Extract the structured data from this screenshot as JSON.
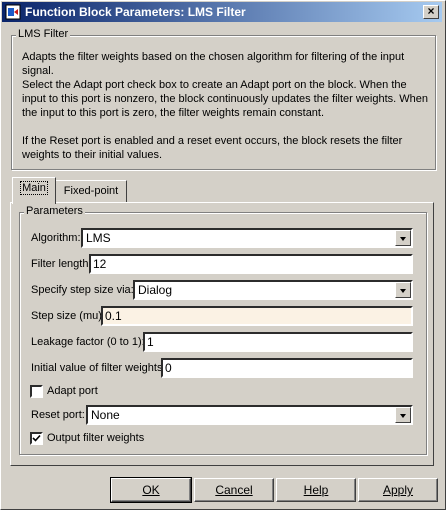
{
  "window": {
    "title": "Function Block Parameters: LMS Filter",
    "close_label": "×"
  },
  "block": {
    "name": "LMS Filter",
    "desc1": "Adapts the filter weights based on the chosen algorithm for filtering of the input signal.",
    "desc2": "Select the Adapt port check box to create an Adapt port on the block. When the input to this port is nonzero, the block continuously updates the filter weights. When the input to this port is zero, the filter weights remain constant.",
    "desc3": "If the Reset port is enabled and a reset event occurs, the block resets the filter weights to their initial values."
  },
  "tabs": [
    {
      "label": "Main",
      "active": true
    },
    {
      "label": "Fixed-point",
      "active": false
    }
  ],
  "params": {
    "group_label": "Parameters",
    "algorithm_label": "Algorithm:",
    "algorithm_value": "LMS",
    "filter_length_label": "Filter length:",
    "filter_length_value": "12",
    "step_via_label": "Specify step size via:",
    "step_via_value": "Dialog",
    "step_size_label": "Step size (mu):",
    "step_size_value": "0.1",
    "leakage_label": "Leakage factor (0 to 1):",
    "leakage_value": "1",
    "init_weights_label": "Initial value of filter weights:",
    "init_weights_value": "0",
    "adapt_port_label": "Adapt port",
    "adapt_port_checked": false,
    "reset_port_label": "Reset port:",
    "reset_port_value": "None",
    "output_weights_label": "Output filter weights",
    "output_weights_checked": true
  },
  "buttons": {
    "ok": "OK",
    "cancel": "Cancel",
    "help": "Help",
    "apply": "Apply"
  }
}
